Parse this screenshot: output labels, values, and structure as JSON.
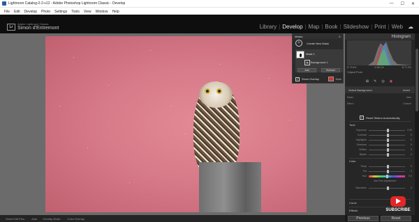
{
  "window": {
    "title": "Lightroom Catalog-2-2-v12 - Adobe Photoshop Lightroom Classic - Develop"
  },
  "menu": [
    "File",
    "Edit",
    "Develop",
    "Photo",
    "Settings",
    "Tools",
    "View",
    "Window",
    "Help"
  ],
  "identity": {
    "badge": "Lr",
    "product": "Adobe Lightroom Classic",
    "user": "Simon d'Entremont"
  },
  "modules": [
    {
      "label": "Library"
    },
    {
      "label": "Develop",
      "active": true
    },
    {
      "label": "Map"
    },
    {
      "label": "Book"
    },
    {
      "label": "Slideshow"
    },
    {
      "label": "Print"
    },
    {
      "label": "Web"
    }
  ],
  "masks_panel": {
    "title": "Masks",
    "create_label": "Create New Mask",
    "mask_name": "Mask 1",
    "background_label": "Background 1",
    "add_label": "Add",
    "subtract_label": "Subtract",
    "overlay_label": "Show Overlay",
    "done_label": "Done"
  },
  "right_panel": {
    "histogram_title": "Histogram",
    "hist_info": [
      "R 79.6%",
      "G 68.1%",
      "B 71.3%"
    ],
    "original_label": "Original Photo",
    "select_label": "Select Background",
    "invert_label": "Invert",
    "mask_label": "Mask :",
    "mask_value": "New",
    "effect_label": "Effect :",
    "effect_value": "Custom",
    "reset_label": "Reset Sliders Automatically",
    "tone_title": "Tone",
    "tone_sliders": [
      {
        "label": "Exposure",
        "value": "0.00"
      },
      {
        "label": "Contrast",
        "value": "0"
      },
      {
        "label": "Highlights",
        "value": "0"
      },
      {
        "label": "Shadows",
        "value": "0"
      },
      {
        "label": "Whites",
        "value": "0"
      },
      {
        "label": "Blacks",
        "value": "0"
      }
    ],
    "color_title": "Color",
    "color_sliders": [
      {
        "label": "Temp",
        "value": "0"
      },
      {
        "label": "Tint",
        "value": "0"
      }
    ],
    "hue_label": "Hue",
    "hue_value": "0.0",
    "range_label": "Use Fine Adjustment",
    "saturation_label": "Saturation",
    "saturation_value": "0",
    "curve_label": "Curve",
    "effects_label": "Effects",
    "prev_label": "Previous",
    "reset_btn_label": "Reset"
  },
  "bottom_toolbar": {
    "show_edit_pins": "Show Edit Pins :",
    "auto": "Auto",
    "overlay_mode": "Overlay Mode :",
    "overlay_value": "Color Overlay"
  },
  "youtube": {
    "label": "SUBSCRIBE"
  },
  "colors": {
    "accent_red": "#e32626",
    "overlay_pink": "#d77a89"
  }
}
